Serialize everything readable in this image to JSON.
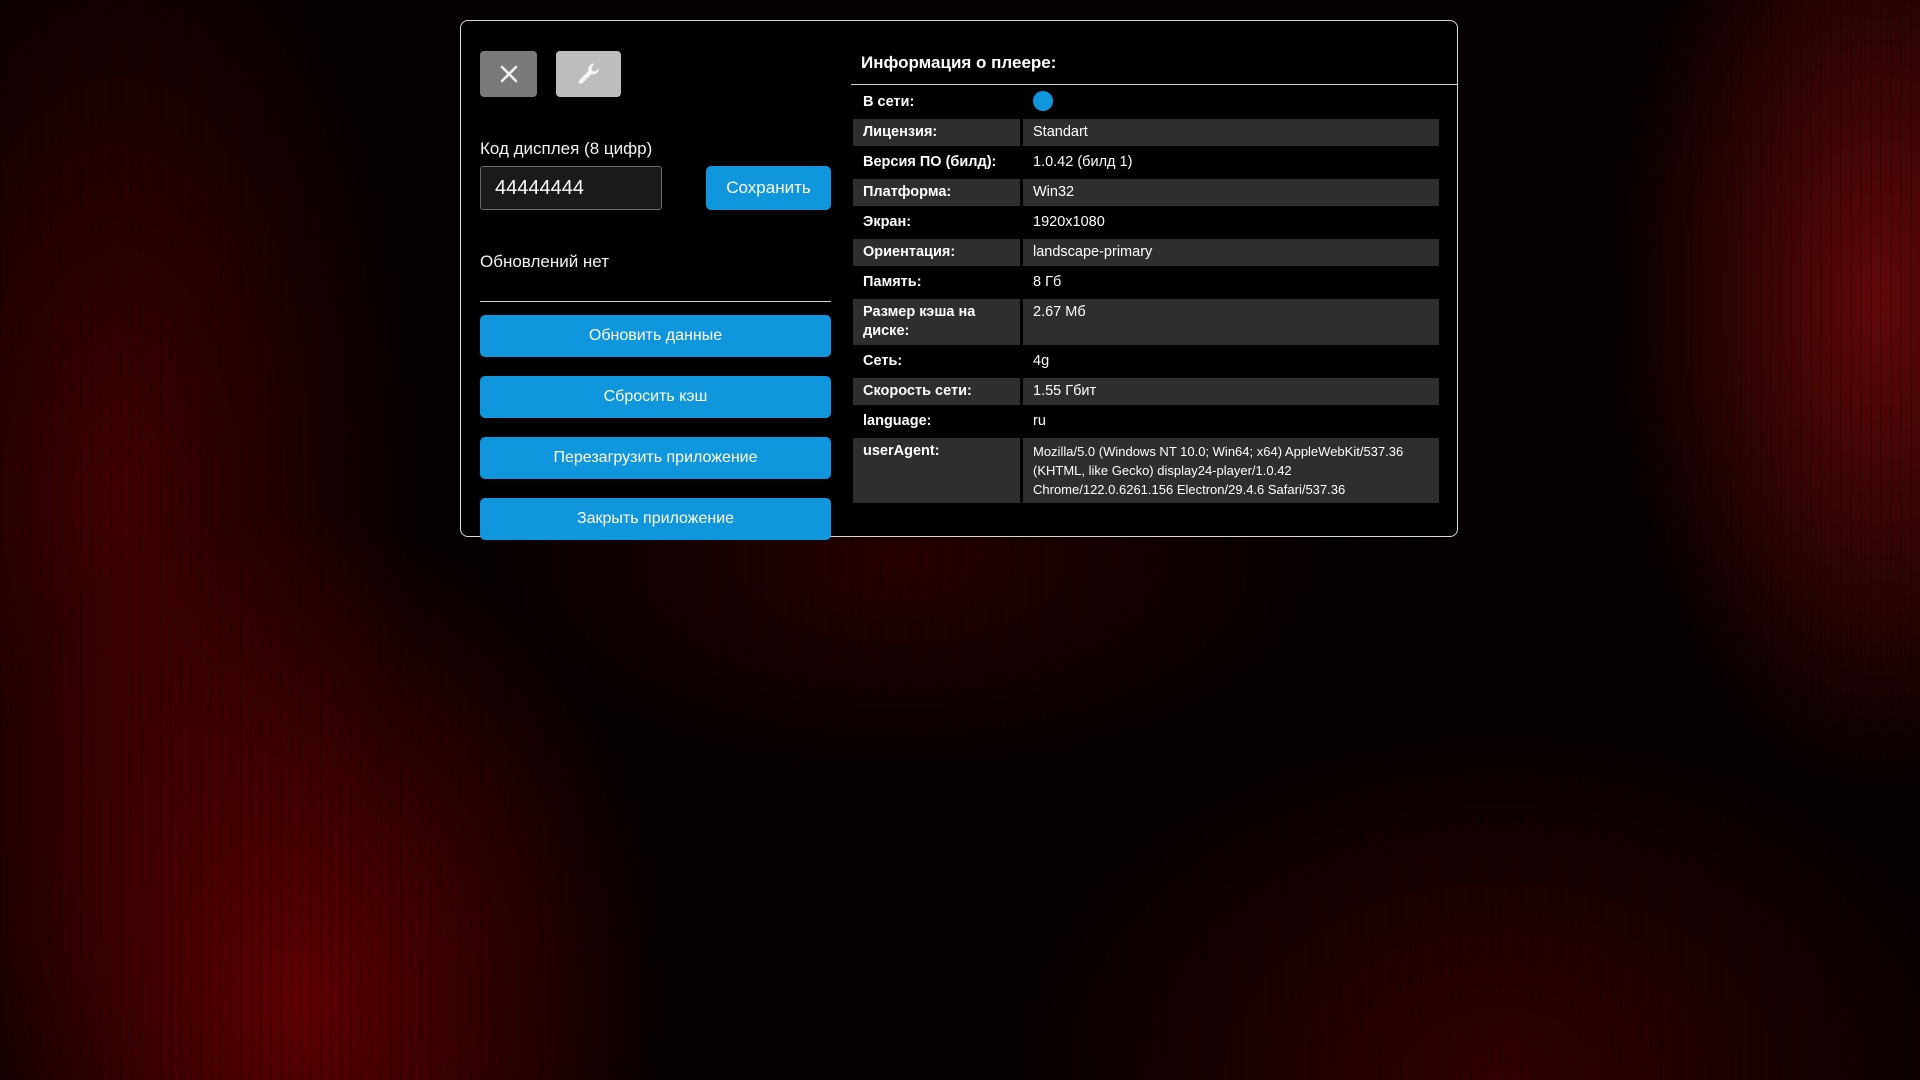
{
  "left_panel": {
    "close_icon": "close-icon",
    "tools_icon": "wrench-icon",
    "code_label": "Код дисплея (8 цифр)",
    "code_value": "44444444",
    "save_label": "Сохранить",
    "update_status": "Обновлений нет",
    "actions": [
      {
        "label": "Обновить данные"
      },
      {
        "label": "Сбросить кэш"
      },
      {
        "label": "Перезагрузить приложение"
      },
      {
        "label": "Закрыть приложение"
      }
    ]
  },
  "info": {
    "title": "Информация о плеере:",
    "online_label": "В сети:",
    "online_status_color": "#0f96dc",
    "rows": [
      {
        "key": "Лицензия:",
        "value": "Standart"
      },
      {
        "key": "Версия ПО (билд):",
        "value": "1.0.42 (билд 1)"
      },
      {
        "key": "Платформа:",
        "value": "Win32"
      },
      {
        "key": "Экран:",
        "value": "1920x1080"
      },
      {
        "key": "Ориентация:",
        "value": "landscape-primary"
      },
      {
        "key": "Память:",
        "value": "8 Гб"
      },
      {
        "key": "Размер кэша на диске:",
        "value": "2.67 Мб"
      },
      {
        "key": "Сеть:",
        "value": "4g"
      },
      {
        "key": "Скорость сети:",
        "value": "1.55 Гбит"
      },
      {
        "key": "language:",
        "value": "ru"
      },
      {
        "key": "userAgent:",
        "value": "Mozilla/5.0 (Windows NT 10.0; Win64; x64) AppleWebKit/537.36 (KHTML, like Gecko) display24-player/1.0.42 Chrome/122.0.6261.156 Electron/29.4.6 Safari/537.36"
      }
    ]
  },
  "colors": {
    "accent": "#0f96dc",
    "close_button": "#7a7a7a",
    "tools_button": "#bdbdbd",
    "row_shade": "#2e2e2e"
  }
}
